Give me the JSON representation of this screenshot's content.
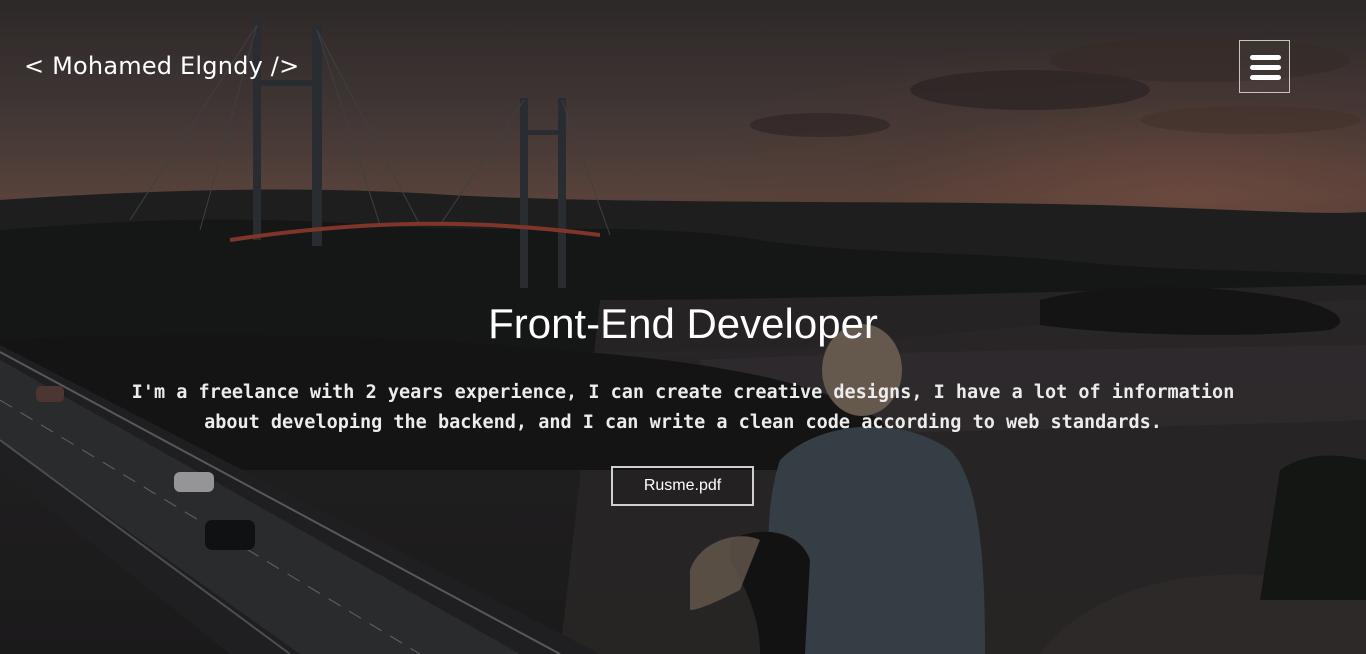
{
  "header": {
    "brand": "< Mohamed Elgndy />",
    "menu_icon": "hamburger-menu-icon"
  },
  "hero": {
    "title": "Front-End Developer",
    "description": "I'm a freelance with 2 years experience, I can create creative designs, I have a lot of information about developing the backend, and I can write a clean code according to web standards.",
    "resume_button_label": "Rusme.pdf"
  },
  "colors": {
    "text": "#ffffff",
    "button_border": "#cfcfcf",
    "sky_accent": "#7a5c52"
  }
}
